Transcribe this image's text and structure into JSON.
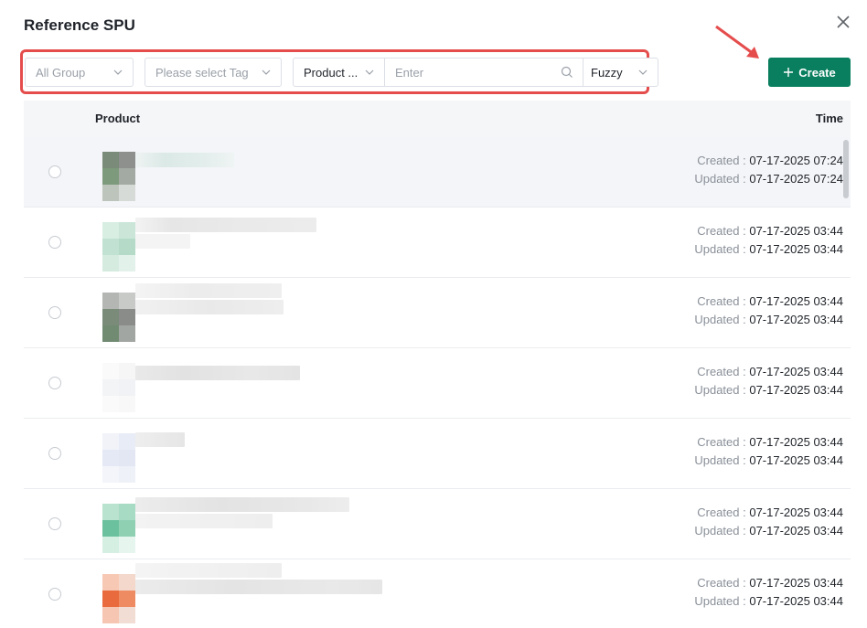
{
  "dialog": {
    "title": "Reference SPU"
  },
  "filters": {
    "group": {
      "value": "All Group"
    },
    "tag": {
      "placeholder": "Please select Tag"
    },
    "field": {
      "value": "Product ..."
    },
    "search": {
      "placeholder": "Enter"
    },
    "match": {
      "value": "Fuzzy"
    }
  },
  "create_label": "Create",
  "table": {
    "columns": [
      "Product",
      "Time"
    ],
    "created_label": "Created :",
    "updated_label": "Updated :",
    "rows": [
      {
        "created": "07-17-2025 07:24",
        "updated": "07-17-2025 07:24"
      },
      {
        "created": "07-17-2025 03:44",
        "updated": "07-17-2025 03:44"
      },
      {
        "created": "07-17-2025 03:44",
        "updated": "07-17-2025 03:44"
      },
      {
        "created": "07-17-2025 03:44",
        "updated": "07-17-2025 03:44"
      },
      {
        "created": "07-17-2025 03:44",
        "updated": "07-17-2025 03:44"
      },
      {
        "created": "07-17-2025 03:44",
        "updated": "07-17-2025 03:44"
      },
      {
        "created": "07-17-2025 03:44",
        "updated": "07-17-2025 03:44"
      }
    ]
  },
  "colors": {
    "primary": "#0a7f5f",
    "annotation": "#e54d4d",
    "selected_row": "#f4f5f8",
    "header_bg": "#f5f6f8"
  },
  "icons": [
    "close-icon",
    "chevron-down-icon",
    "search-icon",
    "plus-icon",
    "annotation-arrow"
  ]
}
